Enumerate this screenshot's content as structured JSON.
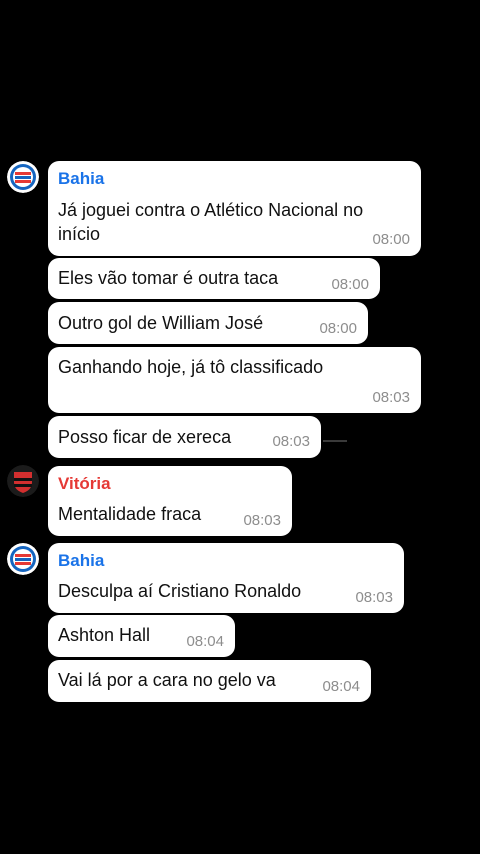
{
  "colors": {
    "background": "#000000",
    "bubble": "#ffffff",
    "text": "#111111",
    "timestamp": "#8d8d8d",
    "bahia_name": "#1a73e8",
    "vitoria_name": "#e53935"
  },
  "avatars": {
    "bahia": "bahia-crest-icon",
    "vitoria": "vitoria-crest-icon"
  },
  "messages": [
    {
      "sender": "Bahia",
      "text_lines": [
        "Já joguei contra o Atlético Nacional no",
        "início"
      ],
      "time": "08:00"
    },
    {
      "text": "Eles vão tomar é outra taca",
      "time": "08:00"
    },
    {
      "text": "Outro gol de William José",
      "time": "08:00"
    },
    {
      "text": "Ganhando hoje, já tô classificado",
      "time": "08:03"
    },
    {
      "text": "Posso ficar de xereca",
      "time": "08:03"
    },
    {
      "sender": "Vitória",
      "text": "Mentalidade fraca",
      "time": "08:03"
    },
    {
      "sender": "Bahia",
      "text": "Desculpa aí Cristiano Ronaldo",
      "time": "08:03"
    },
    {
      "text": "Ashton Hall",
      "time": "08:04"
    },
    {
      "text": "Vai lá por a cara no gelo va",
      "time": "08:04"
    }
  ]
}
